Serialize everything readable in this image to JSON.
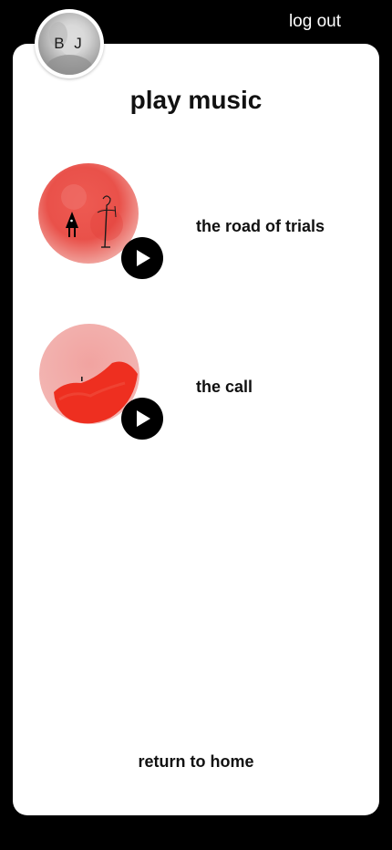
{
  "header": {
    "logout_label": "log out"
  },
  "user": {
    "initials": "B J"
  },
  "main": {
    "title": "play music",
    "tracks": [
      {
        "title": "the road of trials",
        "art_icon": "red-orb-figure-art",
        "play_icon": "play-icon"
      },
      {
        "title": "the call",
        "art_icon": "red-orb-splash-art",
        "play_icon": "play-icon"
      }
    ],
    "return_label": "return to home"
  },
  "colors": {
    "background": "#000000",
    "card": "#ffffff",
    "accent_red": "#e8473e"
  }
}
